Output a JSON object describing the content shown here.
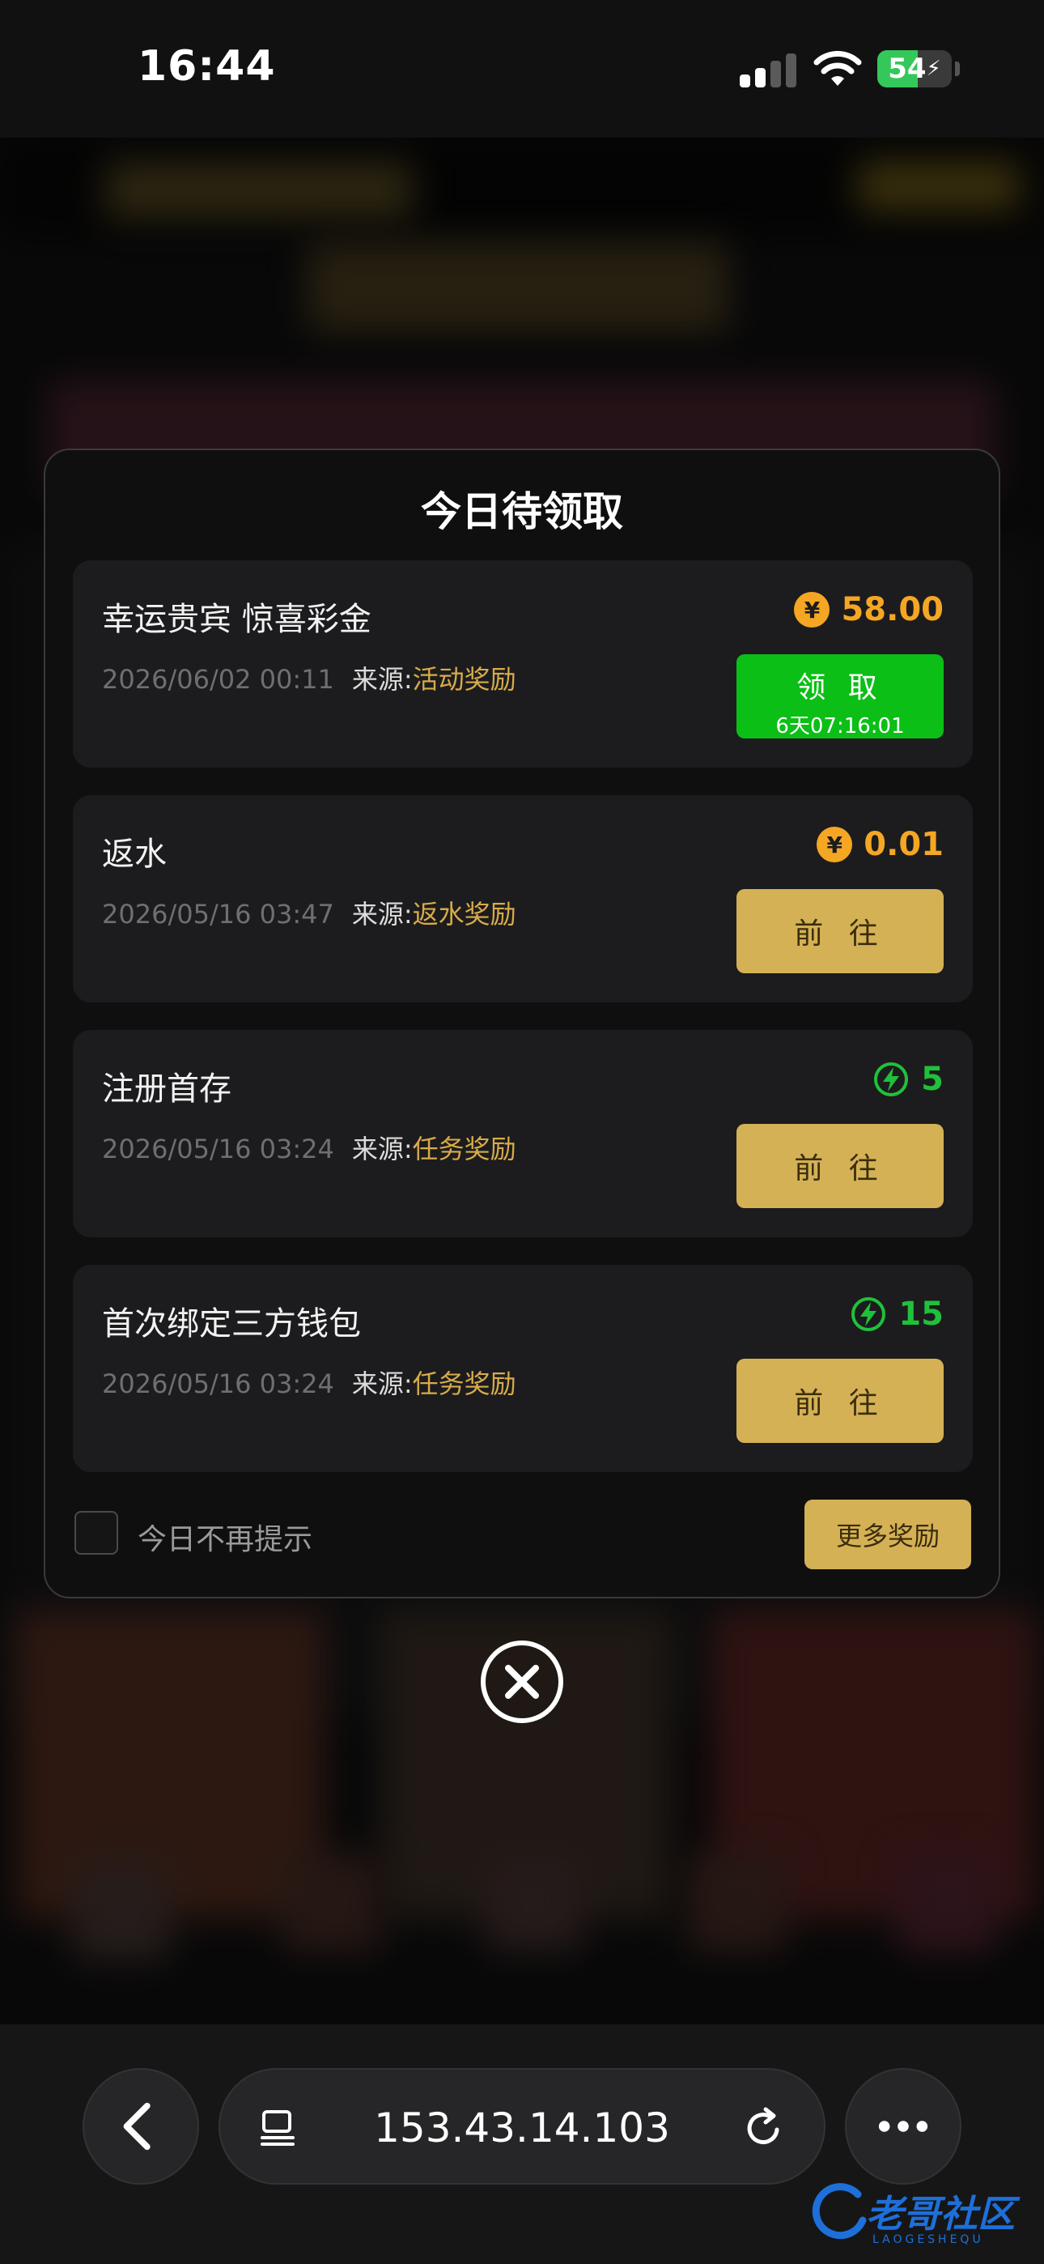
{
  "status_bar": {
    "time": "16:44",
    "battery": "54",
    "battery_level": 0.54
  },
  "modal": {
    "title": "今日待领取",
    "items": [
      {
        "title": "幸运贵宾 惊喜彩金",
        "date": "2026/06/02 00:11",
        "source_label": "来源:",
        "source_type": "活动奖励",
        "reward_icon": "coin-icon",
        "reward_symbol": "¥",
        "reward_value": "58.00",
        "action": "领 取",
        "countdown": "6天07:16:01"
      },
      {
        "title": "返水",
        "date": "2026/05/16 03:47",
        "source_label": "来源:",
        "source_type": "返水奖励",
        "reward_icon": "coin-icon",
        "reward_symbol": "¥",
        "reward_value": "0.01",
        "action": "前 往"
      },
      {
        "title": "注册首存",
        "date": "2026/05/16 03:24",
        "source_label": "来源:",
        "source_type": "任务奖励",
        "reward_icon": "bolt-icon",
        "reward_value": "5",
        "action": "前 往"
      },
      {
        "title": "首次绑定三方钱包",
        "date": "2026/05/16 03:24",
        "source_label": "来源:",
        "source_type": "任务奖励",
        "reward_icon": "bolt-icon",
        "reward_value": "15",
        "action": "前 往"
      }
    ],
    "dont_show_label": "今日不再提示",
    "more_rewards": "更多奖励"
  },
  "browser": {
    "url": "153.43.14.103"
  },
  "watermark": {
    "text": "老哥社区",
    "sub": "LAOGESHEQU"
  },
  "colors": {
    "accent_gold": "#d4b155",
    "claim_green": "#0bbf16",
    "coin_orange": "#f5a623",
    "bolt_green": "#20c13a"
  }
}
